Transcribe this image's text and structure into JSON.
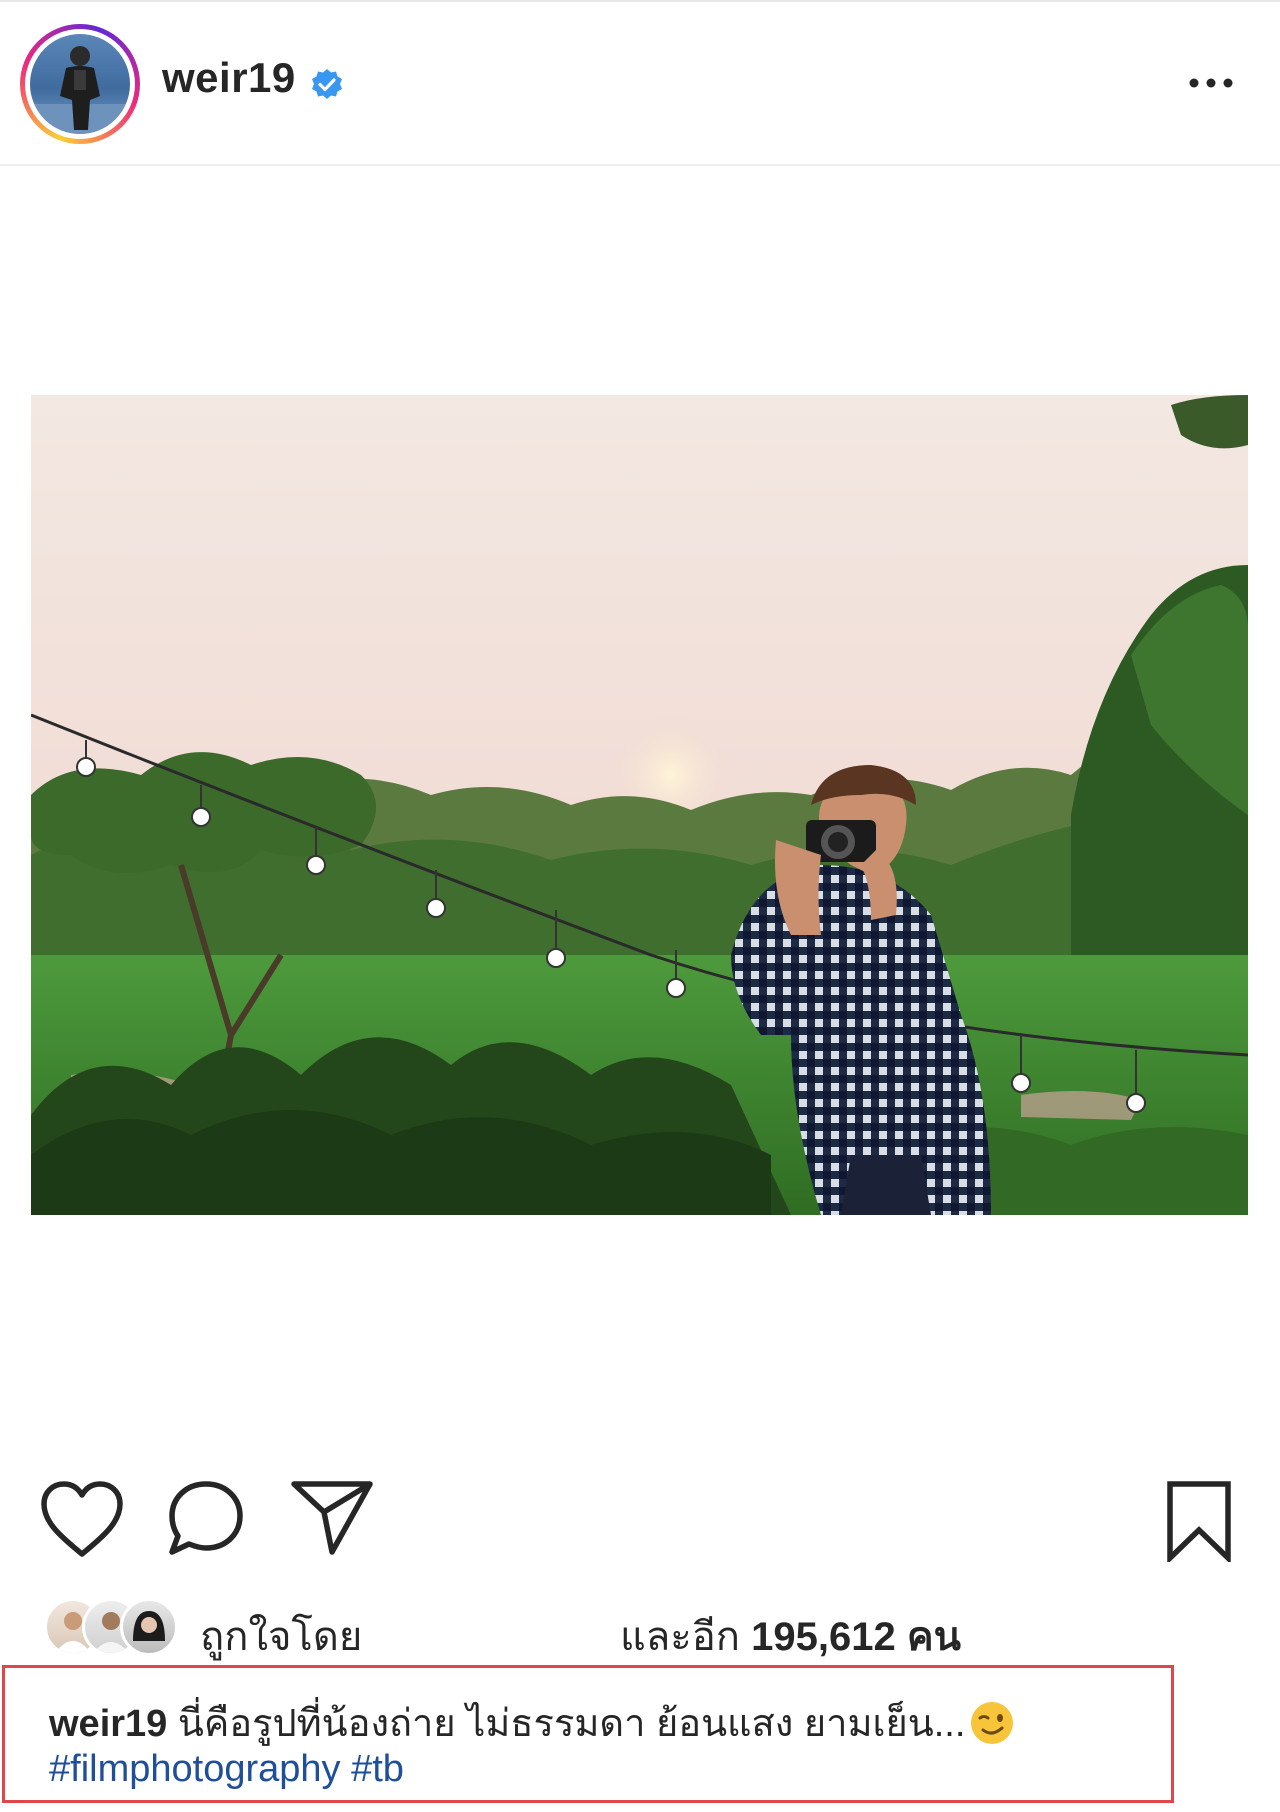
{
  "post": {
    "username": "weir19",
    "verified": true
  },
  "likes": {
    "prefix": "ถูกใจโดย",
    "suffix": "และอีก",
    "count": "195,612",
    "unit": "คน"
  },
  "caption": {
    "username": "weir19",
    "text": " นี่คือรูปที่น้องถ่าย ไม่ธรรมดา ย้อนแสง ยามเย็น...",
    "emoji": "winking-face",
    "hashtags": [
      "#filmphotography",
      "#tb"
    ]
  },
  "icons": {
    "like": "heart-icon",
    "comment": "comment-bubble-icon",
    "share": "paper-plane-icon",
    "save": "bookmark-icon",
    "more": "more-options-icon",
    "verified": "verified-badge-icon"
  },
  "colors": {
    "verified": "#3897f0",
    "hashtag": "#1f4e9a",
    "highlight": "#e0474c"
  }
}
